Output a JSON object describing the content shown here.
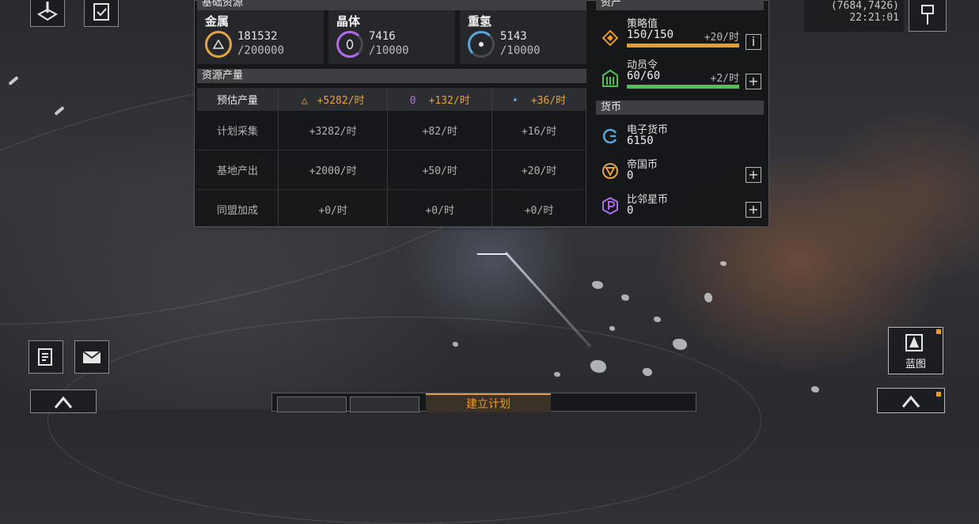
{
  "panel": {
    "section_basic": "基础资源",
    "section_assets": "资产",
    "section_production": "资源产量",
    "section_currency": "货币"
  },
  "resources": [
    {
      "name": "金属",
      "current": "181532",
      "max": "/200000",
      "color": "#e3a544",
      "icon": "metal-triangle-icon"
    },
    {
      "name": "晶体",
      "current": "7416",
      "max": "/10000",
      "color": "#b06cf0",
      "icon": "crystal-icon"
    },
    {
      "name": "重氢",
      "current": "5143",
      "max": "/10000",
      "color": "#5aa6d8",
      "icon": "deuterium-icon"
    }
  ],
  "production": {
    "estimate": {
      "label": "预估产量",
      "metal": "+5282/时",
      "crystal": "+132/时",
      "deuterium": "+36/时"
    },
    "rows": [
      {
        "label": "计划采集",
        "metal": "+3282/时",
        "crystal": "+82/时",
        "deuterium": "+16/时"
      },
      {
        "label": "基地产出",
        "metal": "+2000/时",
        "crystal": "+50/时",
        "deuterium": "+20/时"
      },
      {
        "label": "同盟加成",
        "metal": "+0/时",
        "crystal": "+0/时",
        "deuterium": "+0/时"
      }
    ]
  },
  "assets": [
    {
      "label": "策略值",
      "value": "150/150",
      "rate": "+20/时",
      "fill": 1.0,
      "color": "#e89a2c",
      "button": "i"
    },
    {
      "label": "动员令",
      "value": "60/60",
      "rate": "+2/时",
      "fill": 1.0,
      "color": "#4fc24f",
      "button": "+"
    }
  ],
  "currencies": [
    {
      "label": "电子货币",
      "value": "6150",
      "color": "#5aa6d8"
    },
    {
      "label": "帝国币",
      "value": "0",
      "color": "#e3a544",
      "button": "+"
    },
    {
      "label": "比邻星币",
      "value": "0",
      "color": "#b06cf0",
      "button": "+"
    }
  ],
  "status": {
    "coords": "(7684,7426)",
    "time": "22:21:01"
  },
  "blueprint_label": "蓝图",
  "bottom_tab_label": "建立计划",
  "colors": {
    "accent": "#e89a2c",
    "panel_bg": "#141518",
    "header_bg": "#3e3f43"
  }
}
